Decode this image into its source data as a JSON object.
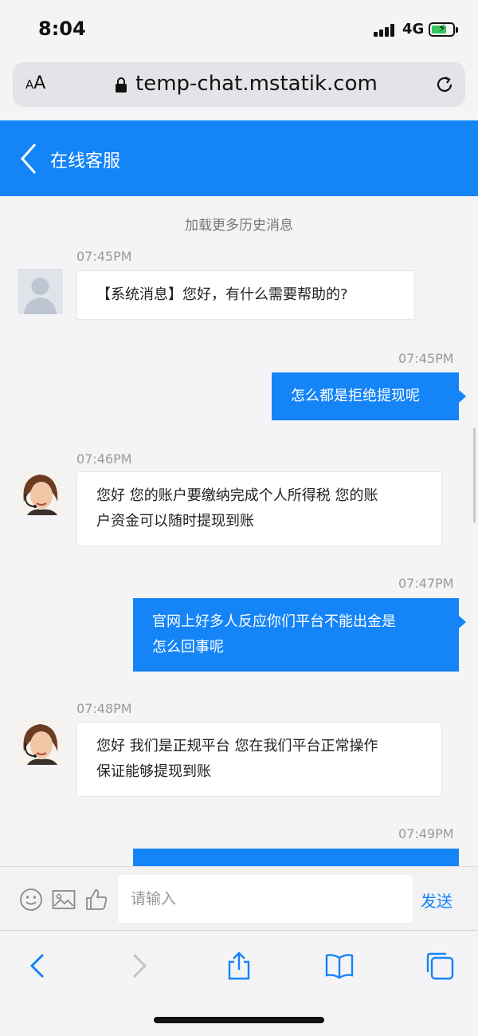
{
  "status_bar": {
    "time": "8:04",
    "network": "4G"
  },
  "browser": {
    "text_size_label": "AA",
    "url": "temp-chat.mstatik.com"
  },
  "chat": {
    "title": "在线客服",
    "load_more": "加载更多历史消息",
    "messages": [
      {
        "side": "in",
        "avatar": "system",
        "time": "07:45PM",
        "lines": [
          "【系统消息】您好，有什么需要帮助的?"
        ]
      },
      {
        "side": "out",
        "time": "07:45PM",
        "lines": [
          "怎么都是拒绝提现呢"
        ]
      },
      {
        "side": "in",
        "avatar": "agent",
        "time": "07:46PM",
        "lines": [
          "您好 您的账户要缴纳完成个人所得税 您的账",
          "户资金可以随时提现到账"
        ]
      },
      {
        "side": "out",
        "time": "07:47PM",
        "lines": [
          "官网上好多人反应你们平台不能出金是",
          "怎么回事呢"
        ]
      },
      {
        "side": "in",
        "avatar": "agent",
        "time": "07:48PM",
        "lines": [
          "您好 我们是正规平台 您在我们平台正常操作",
          "保证能够提现到账"
        ]
      },
      {
        "side": "out",
        "time": "07:49PM",
        "lines": []
      }
    ]
  },
  "input": {
    "placeholder": "请输入",
    "send_label": "发送"
  },
  "colors": {
    "accent": "#1484f7",
    "background": "#f4f4f6"
  }
}
